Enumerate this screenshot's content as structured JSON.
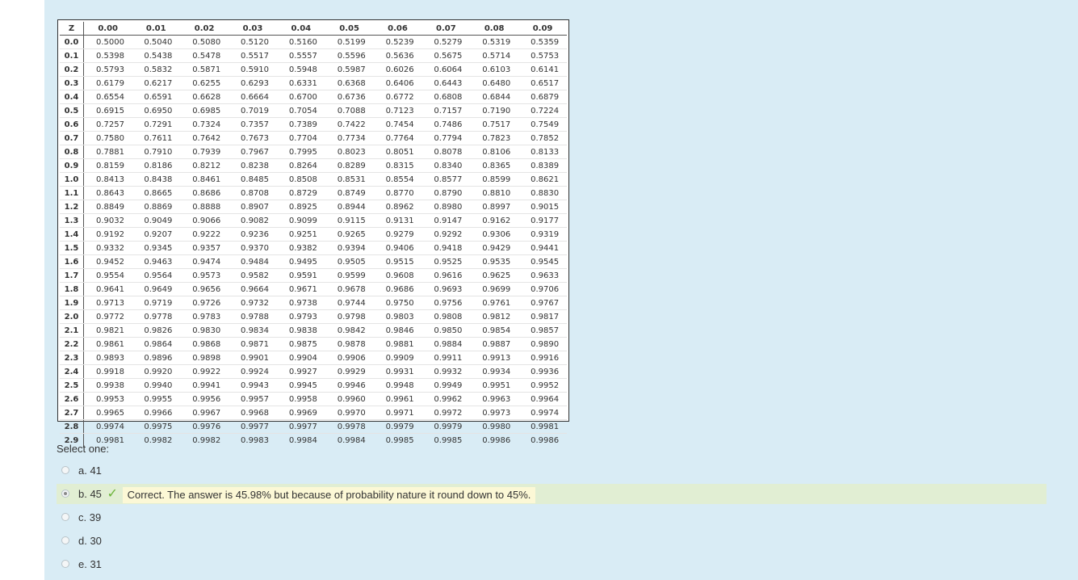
{
  "colors": {
    "panel_background": "#d9ecf5",
    "correct_highlight": "#e1eed3",
    "feedback_background": "#fcf8d6",
    "check": "#6bb43a"
  },
  "ztable": {
    "corner": "Z",
    "columns": [
      "0.00",
      "0.01",
      "0.02",
      "0.03",
      "0.04",
      "0.05",
      "0.06",
      "0.07",
      "0.08",
      "0.09"
    ],
    "rows": [
      {
        "z": "0.0",
        "v": [
          "0.5000",
          "0.5040",
          "0.5080",
          "0.5120",
          "0.5160",
          "0.5199",
          "0.5239",
          "0.5279",
          "0.5319",
          "0.5359"
        ]
      },
      {
        "z": "0.1",
        "v": [
          "0.5398",
          "0.5438",
          "0.5478",
          "0.5517",
          "0.5557",
          "0.5596",
          "0.5636",
          "0.5675",
          "0.5714",
          "0.5753"
        ]
      },
      {
        "z": "0.2",
        "v": [
          "0.5793",
          "0.5832",
          "0.5871",
          "0.5910",
          "0.5948",
          "0.5987",
          "0.6026",
          "0.6064",
          "0.6103",
          "0.6141"
        ]
      },
      {
        "z": "0.3",
        "v": [
          "0.6179",
          "0.6217",
          "0.6255",
          "0.6293",
          "0.6331",
          "0.6368",
          "0.6406",
          "0.6443",
          "0.6480",
          "0.6517"
        ]
      },
      {
        "z": "0.4",
        "v": [
          "0.6554",
          "0.6591",
          "0.6628",
          "0.6664",
          "0.6700",
          "0.6736",
          "0.6772",
          "0.6808",
          "0.6844",
          "0.6879"
        ]
      },
      {
        "z": "0.5",
        "v": [
          "0.6915",
          "0.6950",
          "0.6985",
          "0.7019",
          "0.7054",
          "0.7088",
          "0.7123",
          "0.7157",
          "0.7190",
          "0.7224"
        ]
      },
      {
        "z": "0.6",
        "v": [
          "0.7257",
          "0.7291",
          "0.7324",
          "0.7357",
          "0.7389",
          "0.7422",
          "0.7454",
          "0.7486",
          "0.7517",
          "0.7549"
        ]
      },
      {
        "z": "0.7",
        "v": [
          "0.7580",
          "0.7611",
          "0.7642",
          "0.7673",
          "0.7704",
          "0.7734",
          "0.7764",
          "0.7794",
          "0.7823",
          "0.7852"
        ]
      },
      {
        "z": "0.8",
        "v": [
          "0.7881",
          "0.7910",
          "0.7939",
          "0.7967",
          "0.7995",
          "0.8023",
          "0.8051",
          "0.8078",
          "0.8106",
          "0.8133"
        ]
      },
      {
        "z": "0.9",
        "v": [
          "0.8159",
          "0.8186",
          "0.8212",
          "0.8238",
          "0.8264",
          "0.8289",
          "0.8315",
          "0.8340",
          "0.8365",
          "0.8389"
        ]
      },
      {
        "z": "1.0",
        "v": [
          "0.8413",
          "0.8438",
          "0.8461",
          "0.8485",
          "0.8508",
          "0.8531",
          "0.8554",
          "0.8577",
          "0.8599",
          "0.8621"
        ]
      },
      {
        "z": "1.1",
        "v": [
          "0.8643",
          "0.8665",
          "0.8686",
          "0.8708",
          "0.8729",
          "0.8749",
          "0.8770",
          "0.8790",
          "0.8810",
          "0.8830"
        ]
      },
      {
        "z": "1.2",
        "v": [
          "0.8849",
          "0.8869",
          "0.8888",
          "0.8907",
          "0.8925",
          "0.8944",
          "0.8962",
          "0.8980",
          "0.8997",
          "0.9015"
        ]
      },
      {
        "z": "1.3",
        "v": [
          "0.9032",
          "0.9049",
          "0.9066",
          "0.9082",
          "0.9099",
          "0.9115",
          "0.9131",
          "0.9147",
          "0.9162",
          "0.9177"
        ]
      },
      {
        "z": "1.4",
        "v": [
          "0.9192",
          "0.9207",
          "0.9222",
          "0.9236",
          "0.9251",
          "0.9265",
          "0.9279",
          "0.9292",
          "0.9306",
          "0.9319"
        ]
      },
      {
        "z": "1.5",
        "v": [
          "0.9332",
          "0.9345",
          "0.9357",
          "0.9370",
          "0.9382",
          "0.9394",
          "0.9406",
          "0.9418",
          "0.9429",
          "0.9441"
        ]
      },
      {
        "z": "1.6",
        "v": [
          "0.9452",
          "0.9463",
          "0.9474",
          "0.9484",
          "0.9495",
          "0.9505",
          "0.9515",
          "0.9525",
          "0.9535",
          "0.9545"
        ]
      },
      {
        "z": "1.7",
        "v": [
          "0.9554",
          "0.9564",
          "0.9573",
          "0.9582",
          "0.9591",
          "0.9599",
          "0.9608",
          "0.9616",
          "0.9625",
          "0.9633"
        ]
      },
      {
        "z": "1.8",
        "v": [
          "0.9641",
          "0.9649",
          "0.9656",
          "0.9664",
          "0.9671",
          "0.9678",
          "0.9686",
          "0.9693",
          "0.9699",
          "0.9706"
        ]
      },
      {
        "z": "1.9",
        "v": [
          "0.9713",
          "0.9719",
          "0.9726",
          "0.9732",
          "0.9738",
          "0.9744",
          "0.9750",
          "0.9756",
          "0.9761",
          "0.9767"
        ]
      },
      {
        "z": "2.0",
        "v": [
          "0.9772",
          "0.9778",
          "0.9783",
          "0.9788",
          "0.9793",
          "0.9798",
          "0.9803",
          "0.9808",
          "0.9812",
          "0.9817"
        ]
      },
      {
        "z": "2.1",
        "v": [
          "0.9821",
          "0.9826",
          "0.9830",
          "0.9834",
          "0.9838",
          "0.9842",
          "0.9846",
          "0.9850",
          "0.9854",
          "0.9857"
        ]
      },
      {
        "z": "2.2",
        "v": [
          "0.9861",
          "0.9864",
          "0.9868",
          "0.9871",
          "0.9875",
          "0.9878",
          "0.9881",
          "0.9884",
          "0.9887",
          "0.9890"
        ]
      },
      {
        "z": "2.3",
        "v": [
          "0.9893",
          "0.9896",
          "0.9898",
          "0.9901",
          "0.9904",
          "0.9906",
          "0.9909",
          "0.9911",
          "0.9913",
          "0.9916"
        ]
      },
      {
        "z": "2.4",
        "v": [
          "0.9918",
          "0.9920",
          "0.9922",
          "0.9924",
          "0.9927",
          "0.9929",
          "0.9931",
          "0.9932",
          "0.9934",
          "0.9936"
        ]
      },
      {
        "z": "2.5",
        "v": [
          "0.9938",
          "0.9940",
          "0.9941",
          "0.9943",
          "0.9945",
          "0.9946",
          "0.9948",
          "0.9949",
          "0.9951",
          "0.9952"
        ]
      },
      {
        "z": "2.6",
        "v": [
          "0.9953",
          "0.9955",
          "0.9956",
          "0.9957",
          "0.9958",
          "0.9960",
          "0.9961",
          "0.9962",
          "0.9963",
          "0.9964"
        ]
      },
      {
        "z": "2.7",
        "v": [
          "0.9965",
          "0.9966",
          "0.9967",
          "0.9968",
          "0.9969",
          "0.9970",
          "0.9971",
          "0.9972",
          "0.9973",
          "0.9974"
        ]
      },
      {
        "z": "2.8",
        "v": [
          "0.9974",
          "0.9975",
          "0.9976",
          "0.9977",
          "0.9977",
          "0.9978",
          "0.9979",
          "0.9979",
          "0.9980",
          "0.9981"
        ]
      },
      {
        "z": "2.9",
        "v": [
          "0.9981",
          "0.9982",
          "0.9982",
          "0.9983",
          "0.9984",
          "0.9984",
          "0.9985",
          "0.9985",
          "0.9986",
          "0.9986"
        ]
      }
    ]
  },
  "question": {
    "prompt": "Select one:",
    "answers": [
      {
        "label": "a. 41",
        "selected": false,
        "correct": false
      },
      {
        "label": "b. 45",
        "selected": true,
        "correct": true,
        "feedback": "Correct. The answer is 45.98% but because of probability nature it round down to 45%.",
        "icon": "check-icon"
      },
      {
        "label": "c. 39",
        "selected": false,
        "correct": false
      },
      {
        "label": "d. 30",
        "selected": false,
        "correct": false
      },
      {
        "label": "e. 31",
        "selected": false,
        "correct": false
      }
    ]
  }
}
